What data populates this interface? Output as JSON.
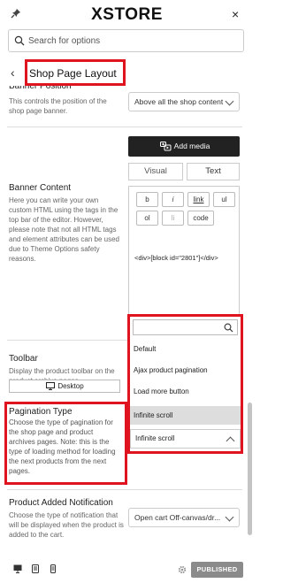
{
  "header": {
    "brand_x": "X",
    "brand_rest": "STORE",
    "close": "×"
  },
  "search": {
    "placeholder": "Search for options"
  },
  "section": {
    "back": "‹",
    "title": "Shop Page Layout"
  },
  "banner_position": {
    "label": "Banner Position",
    "desc": "This controls the position of the shop page banner.",
    "value": "Above all the shop content"
  },
  "banner_content": {
    "label": "Banner Content",
    "desc": "Here you can write your own custom HTML using the tags in the top bar of the editor. However, please note that not all HTML tags and element attributes can be used due to Theme Options safety reasons.",
    "add_media": "Add media",
    "tab_visual": "Visual",
    "tab_text": "Text",
    "toolbar": [
      "b",
      "i",
      "link",
      "ul",
      "ol",
      "li",
      "code"
    ],
    "content": "<div>[block id=\"2801\"]</div>"
  },
  "toolbar_option": {
    "label": "Toolbar",
    "desc": "Display the product toolbar on the product archive pages.",
    "device": "Desktop"
  },
  "pagination": {
    "label": "Pagination Type",
    "desc": "Choose the type of pagination for the shop page and product archives pages. Note: this is the type of loading method for loading the next products from the next pages.",
    "options": [
      "Default",
      "Ajax product pagination",
      "Load more button",
      "Infinite scroll"
    ],
    "selected": "Infinite scroll"
  },
  "notification": {
    "label": "Product Added Notification",
    "desc": "Choose the type of notification that will be displayed when the product is added to the cart.",
    "value": "Open cart Off-canvas/dr..."
  },
  "footer": {
    "publish": "PUBLISHED"
  },
  "colors": {
    "highlight": "#e0141e",
    "dark_button": "#222222",
    "published": "#8b8b8b"
  }
}
